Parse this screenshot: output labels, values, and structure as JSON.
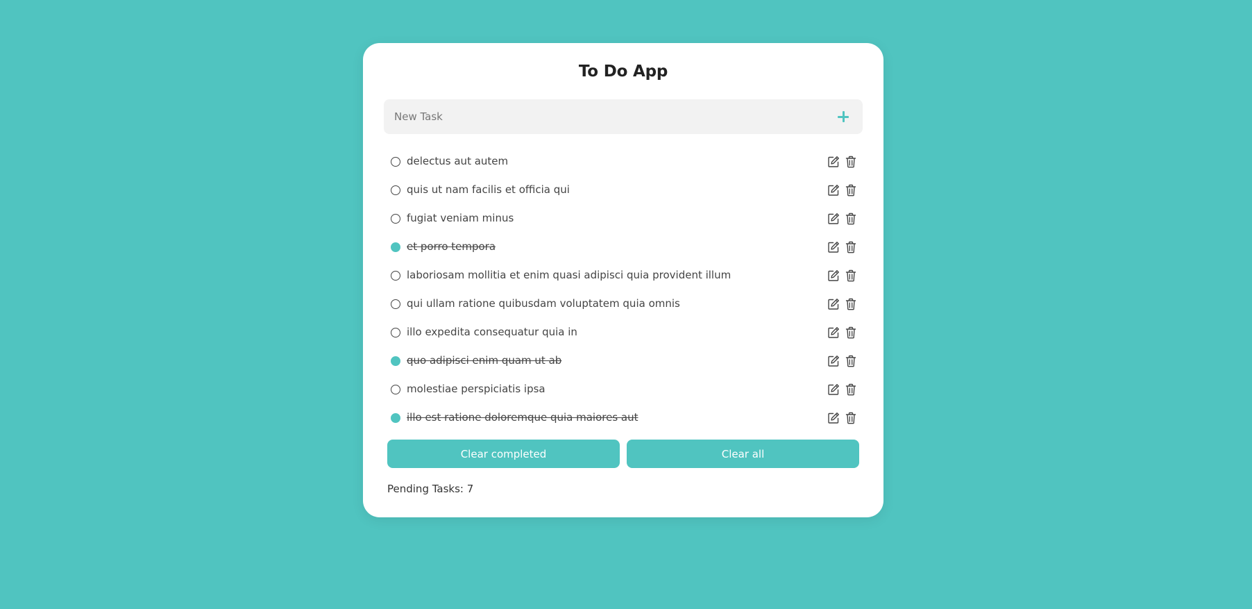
{
  "app": {
    "title": "To Do App",
    "accent_color": "#50c4c0",
    "background_color": "#50c4c0"
  },
  "new_task": {
    "placeholder": "New Task",
    "value": "",
    "add_icon": "plus-icon"
  },
  "tasks": [
    {
      "text": "delectus aut autem",
      "completed": false
    },
    {
      "text": "quis ut nam facilis et officia qui",
      "completed": false
    },
    {
      "text": "fugiat veniam minus",
      "completed": false
    },
    {
      "text": "et porro tempora",
      "completed": true
    },
    {
      "text": "laboriosam mollitia et enim quasi adipisci quia provident illum",
      "completed": false
    },
    {
      "text": "qui ullam ratione quibusdam voluptatem quia omnis",
      "completed": false
    },
    {
      "text": "illo expedita consequatur quia in",
      "completed": false
    },
    {
      "text": "quo adipisci enim quam ut ab",
      "completed": true
    },
    {
      "text": "molestiae perspiciatis ipsa",
      "completed": false
    },
    {
      "text": "illo est ratione doloremque quia maiores aut",
      "completed": true
    }
  ],
  "task_icons": {
    "edit": "edit-icon",
    "delete": "trash-icon"
  },
  "actions": {
    "clear_completed_label": "Clear completed",
    "clear_all_label": "Clear all"
  },
  "footer": {
    "pending_text": "Pending Tasks: 7"
  }
}
